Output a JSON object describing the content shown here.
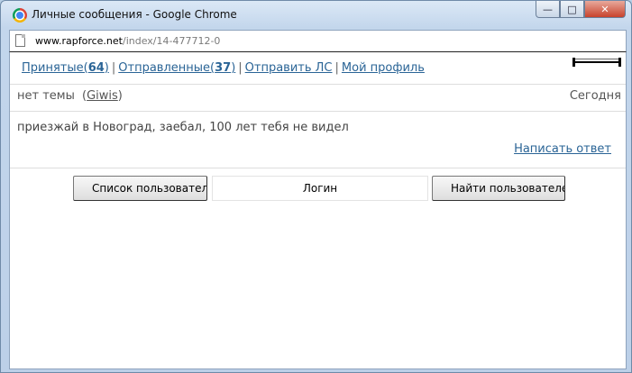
{
  "window": {
    "title": "Личные сообщения - Google Chrome",
    "controls": {
      "minimize": "—",
      "maximize": "□",
      "close": "✕"
    }
  },
  "address": {
    "domain": "www.rapforce.net",
    "path": "/index/14-477712-0"
  },
  "nav": {
    "received_label": "Принятые(",
    "received_count": "64",
    "received_close": ")",
    "sent_label": "Отправленные(",
    "sent_count": "37",
    "sent_close": ")",
    "separator": "|",
    "send_label": "Отправить ЛС",
    "profile_label": "Мой профиль"
  },
  "message": {
    "subject": "нет темы",
    "author_open": "(",
    "author": "Giwis",
    "author_close": ")",
    "date": "Сегодня",
    "body": "приезжай в Новоград, заебал, 100 лет тебя не видел",
    "reply_label": "Написать ответ"
  },
  "controls": {
    "user_list_button": "Список пользователей",
    "login_value": "Логин",
    "find_user_button": "Найти пользователей"
  },
  "colors": {
    "link": "#2a6496",
    "frame": "#bcd0e8"
  }
}
